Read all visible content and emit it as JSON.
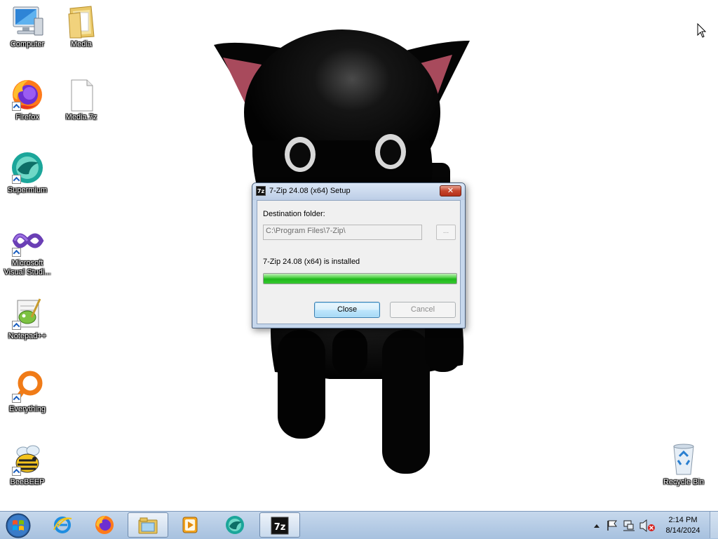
{
  "desktop": {
    "icons": [
      {
        "label": "Computer",
        "icon": "computer-icon"
      },
      {
        "label": "Media",
        "icon": "folder-icon"
      },
      {
        "label": "Firefox",
        "icon": "firefox-icon"
      },
      {
        "label": "Media.7z",
        "icon": "file-icon"
      },
      {
        "label": "Supermium",
        "icon": "supermium-icon"
      },
      {
        "label": "Microsoft Visual Studi...",
        "icon": "visual-studio-icon"
      },
      {
        "label": "Notepad++",
        "icon": "notepadplusplus-icon"
      },
      {
        "label": "Everything",
        "icon": "everything-icon"
      },
      {
        "label": "BeeBEEP",
        "icon": "beebeep-icon"
      },
      {
        "label": "Recycle Bin",
        "icon": "recycle-bin-icon"
      }
    ]
  },
  "dialog": {
    "app_icon": "7z",
    "title": "7-Zip 24.08 (x64) Setup",
    "close_glyph": "✕",
    "destination_label": "Destination folder:",
    "destination_value": "C:\\Program Files\\7-Zip\\",
    "browse_label": "...",
    "status": "7-Zip 24.08 (x64) is installed",
    "progress": 1.0,
    "close_button": "Close",
    "cancel_button": "Cancel"
  },
  "taskbar": {
    "apps": [
      {
        "name": "Internet Explorer",
        "icon": "internet-explorer-icon",
        "active": false
      },
      {
        "name": "Firefox",
        "icon": "firefox-icon",
        "active": false
      },
      {
        "name": "Windows Explorer",
        "icon": "explorer-folder-icon",
        "active": true
      },
      {
        "name": "Media Player",
        "icon": "media-player-icon",
        "active": false
      },
      {
        "name": "Supermium",
        "icon": "supermium-icon",
        "active": false
      },
      {
        "name": "7-Zip Setup",
        "icon": "7zip-icon",
        "active": true
      }
    ],
    "tray_icons": [
      "show-hidden-icons-icon",
      "action-center-flag-icon",
      "network-icon",
      "volume-muted-icon"
    ],
    "clock": {
      "time": "2:14 PM",
      "date": "8/14/2024"
    }
  },
  "colors": {
    "progress_green": "#1fb81b",
    "cat_black": "#050505",
    "ear_pink": "#a84a5c"
  }
}
